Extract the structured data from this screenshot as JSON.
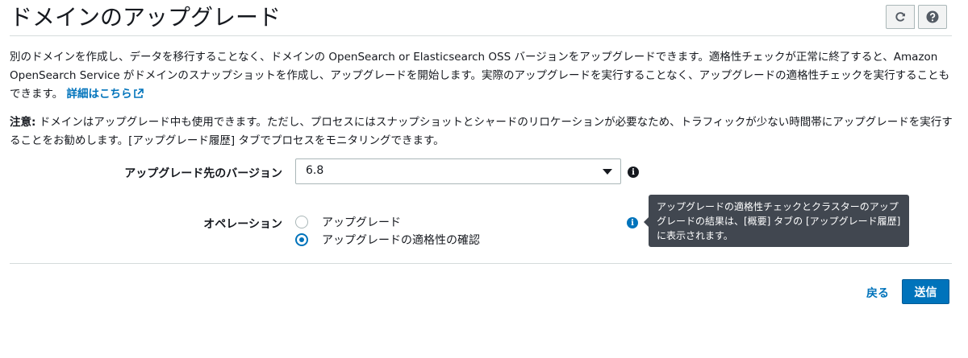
{
  "header": {
    "title": "ドメインのアップグレード",
    "refresh_icon": "refresh-icon",
    "help_icon": "help-icon"
  },
  "intro": {
    "text": "別のドメインを作成し、データを移行することなく、ドメインの OpenSearch or Elasticsearch OSS バージョンをアップグレードできます。適格性チェックが正常に終了すると、Amazon OpenSearch Service がドメインのスナップショットを作成し、アップグレードを開始します。実際のアップグレードを実行することなく、アップグレードの適格性チェックを実行することもできます。",
    "link_label": "詳細はこちら"
  },
  "note": {
    "label": "注意:",
    "text": " ドメインはアップグレード中も使用できます。ただし、プロセスにはスナップショットとシャードのリロケーションが必要なため、トラフィックが少ない時間帯にアップグレードを実行することをお勧めします。[アップグレード履歴] タブでプロセスをモニタリングできます。"
  },
  "form": {
    "version_label": "アップグレード先のバージョン",
    "version_value": "6.8",
    "operation_label": "オペレーション",
    "options": [
      {
        "label": "アップグレード",
        "selected": false
      },
      {
        "label": "アップグレードの適格性の確認",
        "selected": true
      }
    ],
    "tooltip": "アップグレードの適格性チェックとクラスターのアップグレードの結果は、[概要] タブの [アップグレード履歴] に表示されます。"
  },
  "footer": {
    "back_label": "戻る",
    "submit_label": "送信"
  },
  "colors": {
    "accent": "#0073bb",
    "tooltip_bg": "#414750"
  }
}
